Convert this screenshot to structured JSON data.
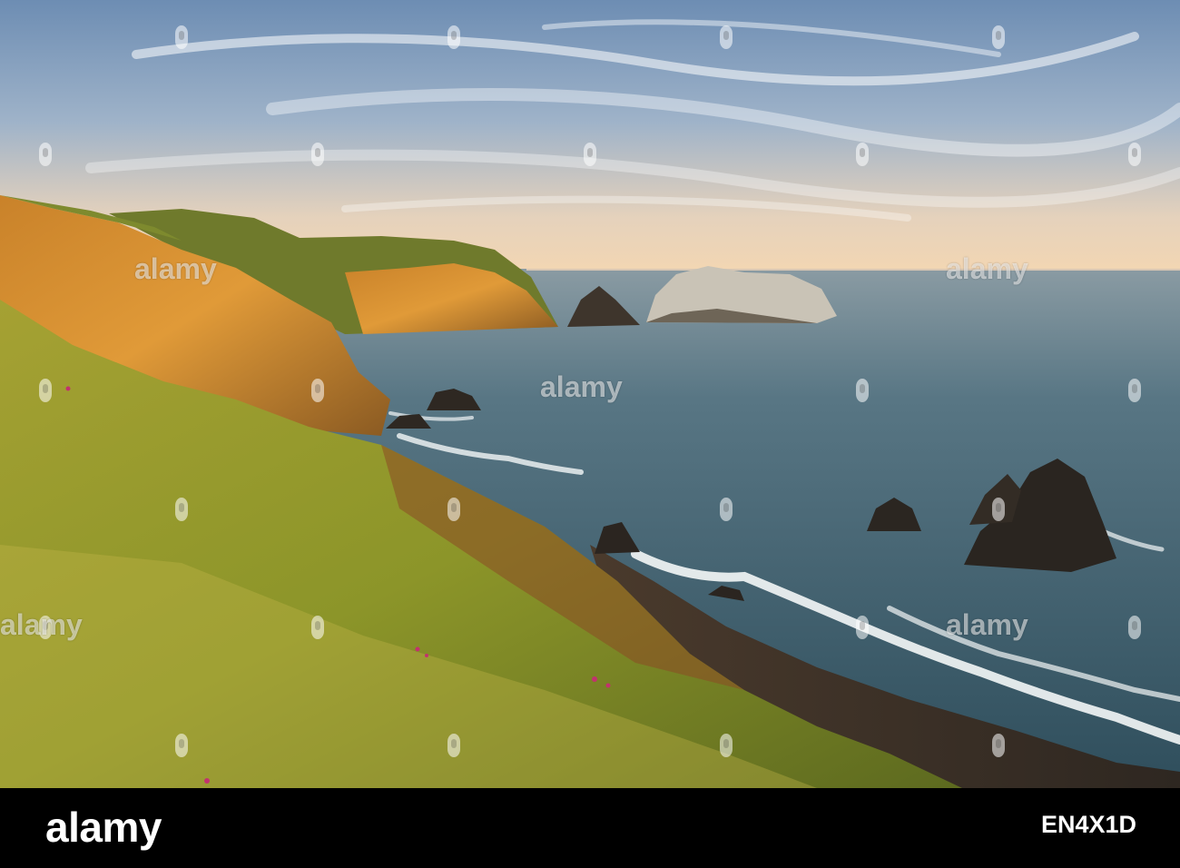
{
  "photo": {
    "watermark_text": "alamy",
    "subject": "coastal-cliffs-sunset",
    "colors": {
      "sky_top": "#6f8fb4",
      "sky_bottom": "#f1d6b4",
      "ocean": "#3c5e6c",
      "cliff_lit": "#d18a2e",
      "grass": "#8d9a2a",
      "beach": "#3b3128",
      "surf": "#ffffff"
    }
  },
  "footer": {
    "logo": "alamy",
    "image_code": "EN4X1D",
    "caption": "",
    "url": ""
  }
}
